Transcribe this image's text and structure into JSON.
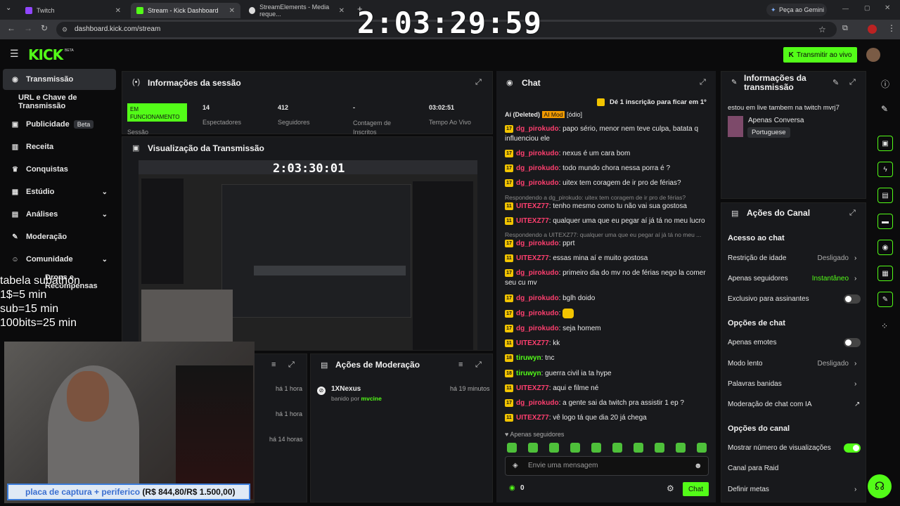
{
  "browser": {
    "tabs": [
      {
        "title": "Twitch",
        "color": "#9146ff"
      },
      {
        "title": "Stream - Kick Dashboard",
        "color": "#53fc18"
      },
      {
        "title": "StreamElements - Media reque...",
        "color": "#dddddd"
      }
    ],
    "gemini": "Peça ao Gemini",
    "url": "dashboard.kick.com/stream"
  },
  "overlay": {
    "big_timer": "2:03:29:59",
    "mini_timer": "2:03:30:01",
    "subathon_lines": [
      "tabela subathon",
      "1$=5 min",
      "sub=15 min",
      "100bits=25 min"
    ],
    "goal_label": "placa de captura + periferico",
    "goal_value": "(R$ 844,80/R$ 1.500,00)"
  },
  "header": {
    "logo": "KICK",
    "beta": "BETA",
    "live_button": "Transmitir ao vivo"
  },
  "sidebar": {
    "items": [
      {
        "label": "Transmissão",
        "icon": "broadcast-icon"
      },
      {
        "label": "URL e Chave de Transmissão"
      },
      {
        "label": "Publicidade",
        "icon": "megaphone-icon",
        "badge": "Beta"
      },
      {
        "label": "Receita",
        "icon": "chart-icon"
      },
      {
        "label": "Conquistas",
        "icon": "trophy-icon"
      },
      {
        "label": "Estúdio",
        "icon": "studio-icon"
      },
      {
        "label": "Análises",
        "icon": "analytics-icon"
      },
      {
        "label": "Moderação",
        "icon": "wrench-icon"
      },
      {
        "label": "Comunidade",
        "icon": "community-icon"
      },
      {
        "label": "Drops e Recompensas"
      }
    ]
  },
  "session": {
    "title": "Informações da sessão",
    "status": "EM FUNCIONAMENTO",
    "status_label": "Sessão",
    "stats": [
      {
        "value": "14",
        "label": "Espectadores"
      },
      {
        "value": "412",
        "label": "Seguidores"
      },
      {
        "value": "-",
        "label": "Contagem de Inscritos"
      },
      {
        "value": "03:02:51",
        "label": "Tempo Ao Vivo"
      }
    ]
  },
  "preview": {
    "title": "Visualização da Transmissão"
  },
  "activity": {
    "times": [
      "há 1 hora",
      "há 1 hora",
      "há 14 horas"
    ]
  },
  "moderation": {
    "title": "Ações de Moderação",
    "user": "1XNexus",
    "time": "há 19 minutos",
    "action_prefix": "banido por",
    "moderator": "mvcine"
  },
  "chat": {
    "title": "Chat",
    "banner": "Dé 1 inscrição para ficar em 1º",
    "top_line": {
      "user": "Aí (Deleted)",
      "badge": "AI Mod",
      "text": "[ódio]"
    },
    "messages": [
      {
        "lv": "17",
        "user": "dg_pirokudo",
        "text": "papo sério, menor nem teve culpa, batata q influenciou ele",
        "color": "r"
      },
      {
        "lv": "17",
        "user": "dg_pirokudo",
        "text": "nexus é um cara bom",
        "color": "r"
      },
      {
        "lv": "17",
        "user": "dg_pirokudo",
        "text": "todo mundo chora nessa porra é ?",
        "color": "r"
      },
      {
        "lv": "17",
        "user": "dg_pirokudo",
        "text": "uitex tem coragem de ir pro de férias?",
        "color": "r"
      },
      {
        "lv": "11",
        "user": "UITEXZ77",
        "text": "tenho mesmo como tu não vai sua gostosa",
        "color": "r"
      },
      {
        "lv": "11",
        "user": "UITEXZ77",
        "text": "qualquer uma que eu pegar aí já tá no meu lucro",
        "color": "r"
      },
      {
        "lv": "17",
        "user": "dg_pirokudo",
        "text": "pprt",
        "color": "r"
      },
      {
        "lv": "11",
        "user": "UITEXZ77",
        "text": "essas mina aí e muito gostosa",
        "color": "r"
      },
      {
        "lv": "17",
        "user": "dg_pirokudo",
        "text": "primeiro dia do mv no de férias nego la comer seu cu mv",
        "color": "r"
      },
      {
        "lv": "17",
        "user": "dg_pirokudo",
        "text": "bglh doido",
        "color": "r"
      },
      {
        "lv": "17",
        "user": "dg_pirokudo",
        "text": "",
        "color": "r"
      },
      {
        "lv": "17",
        "user": "dg_pirokudo",
        "text": "seja homem",
        "color": "r"
      },
      {
        "lv": "11",
        "user": "UITEXZ77",
        "text": "kk",
        "color": "r"
      },
      {
        "lv": "18",
        "user": "tiruwyn",
        "text": "tnc",
        "color": "g"
      },
      {
        "lv": "18",
        "user": "tiruwyn",
        "text": "guerra civil ia ta hype",
        "color": "g"
      },
      {
        "lv": "11",
        "user": "UITEXZ77",
        "text": "aqui e filme né",
        "color": "r"
      },
      {
        "lv": "17",
        "user": "dg_pirokudo",
        "text": "a gente sai da twitch pra assistir 1 ep ?",
        "color": "r"
      },
      {
        "lv": "11",
        "user": "UITEXZ77",
        "text": "vê logo tá que dia 20 já chega",
        "color": "r"
      }
    ],
    "replies": [
      "Respondendo a dg_pirokudo: uitex tem coragem de ir pro de férias?",
      "Respondendo a UITEXZ77: qualquer uma que eu pegar aí já tá no meu ..."
    ],
    "followers_only": "Apenas seguidores",
    "input_placeholder": "Envie uma mensagem",
    "viewer_count": "0",
    "send_label": "Chat"
  },
  "stream_info": {
    "title": "Informações da transmissão",
    "description": "estou em live tambem na twitch mvrj7",
    "category": "Apenas Conversa",
    "language": "Portuguese"
  },
  "channel_actions": {
    "title": "Ações do Canal",
    "sections": [
      {
        "heading": "Acesso ao chat"
      },
      {
        "heading": "Opções de chat"
      },
      {
        "heading": "Opções do canal"
      }
    ],
    "rows": [
      {
        "label": "Restrição de idade",
        "value": "Desligado",
        "kind": "chevron"
      },
      {
        "label": "Apenas seguidores",
        "value": "Instantâneo",
        "kind": "chevron",
        "green": true
      },
      {
        "label": "Exclusivo para assinantes",
        "kind": "toggle",
        "on": false
      },
      {
        "label": "Apenas emotes",
        "kind": "toggle",
        "on": false
      },
      {
        "label": "Modo lento",
        "value": "Desligado",
        "kind": "chevron"
      },
      {
        "label": "Palavras banidas",
        "kind": "chevron"
      },
      {
        "label": "Moderação de chat com IA",
        "kind": "external"
      },
      {
        "label": "Mostrar número de visualizações",
        "kind": "toggle",
        "on": true
      },
      {
        "label": "Canal para Raid",
        "kind": "none"
      },
      {
        "label": "Definir metas",
        "kind": "chevron"
      }
    ]
  },
  "colors": {
    "accent": "#53fc18",
    "panel": "#18191c",
    "red_user": "#ff3f6f"
  }
}
